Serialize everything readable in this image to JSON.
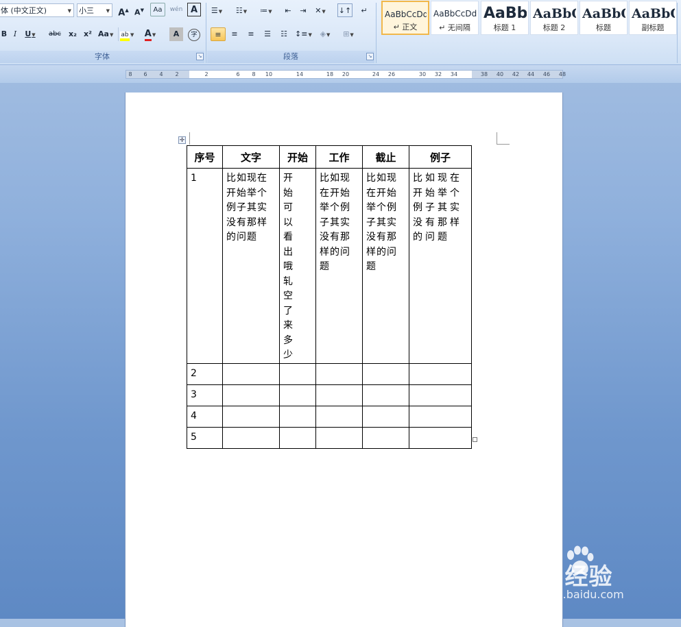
{
  "ribbon": {
    "font_group": {
      "font_name": "体 (中文正文)",
      "font_size": "小三",
      "caption": "字体",
      "grow_label": "A",
      "shrink_label": "A",
      "bold": "B",
      "italic": "I",
      "underline": "U",
      "strike": "abc",
      "subscript": "x₂",
      "superscript": "x²",
      "change_case": "Aa",
      "font_color_label": "A",
      "char_shading_label": "A",
      "phonetic_label": "wén"
    },
    "paragraph_group": {
      "caption": "段落"
    },
    "styles": [
      {
        "sample": "AaBbCcDd",
        "name": "↵ 正文",
        "selected": true
      },
      {
        "sample": "AaBbCcDd",
        "name": "↵ 无间隔",
        "selected": false
      },
      {
        "sample": "AaBb",
        "name": "标题 1",
        "selected": false
      },
      {
        "sample": "AaBbC",
        "name": "标题 2",
        "selected": false
      },
      {
        "sample": "AaBbC",
        "name": "标题",
        "selected": false
      },
      {
        "sample": "AaBbC",
        "name": "副标题",
        "selected": false
      }
    ]
  },
  "ruler": {
    "ticks": [
      "8",
      "6",
      "4",
      "2",
      "2",
      "6",
      "8",
      "10",
      "14",
      "18",
      "20",
      "24",
      "26",
      "30",
      "32",
      "34",
      "38",
      "40",
      "42",
      "44",
      "46",
      "48"
    ]
  },
  "table": {
    "headers": [
      "序号",
      "文字",
      "开始",
      "工作",
      "截止",
      "例子"
    ],
    "rows": [
      [
        "1",
        "比如现在开始举个例子其实没有那样的问题",
        "开始可以看出哦轧空了来多少",
        "比如现在开始举个例子其实没有那样的问题",
        "比如现在开始举个例子其实没有那样的问题",
        "比如现在开始举个例子其实没有那样的问题"
      ],
      [
        "2",
        "",
        "",
        "",
        "",
        ""
      ],
      [
        "3",
        "",
        "",
        "",
        "",
        ""
      ],
      [
        "4",
        "",
        "",
        "",
        "",
        ""
      ],
      [
        "5",
        "",
        "",
        "",
        "",
        ""
      ]
    ]
  },
  "watermark": {
    "main": "Bai经验",
    "sub": "jingyan.baidu.com"
  }
}
